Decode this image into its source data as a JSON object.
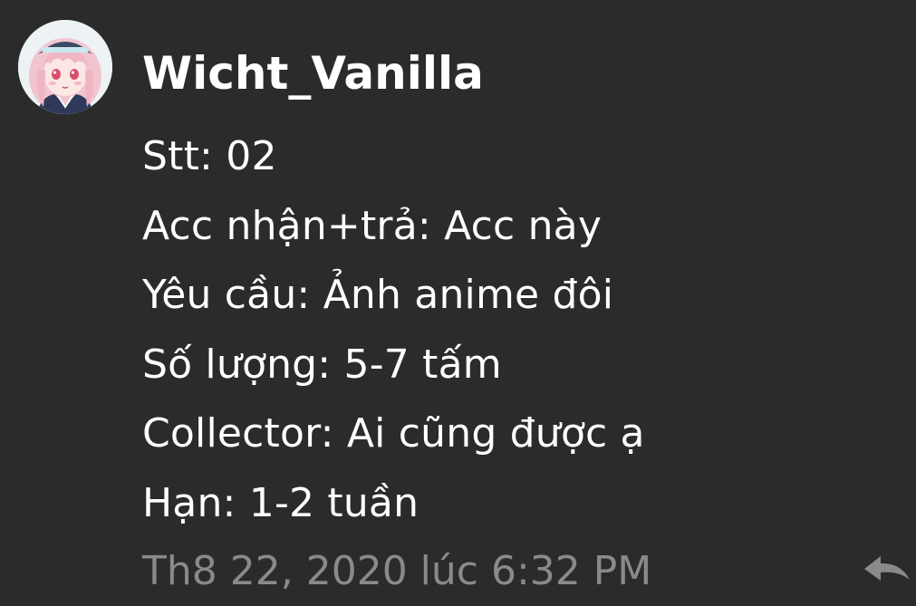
{
  "message": {
    "username": "Wicht_Vanilla",
    "avatar_icon": "anime-girl-avatar-icon",
    "lines": [
      "Stt: 02",
      "Acc nhận+trả: Acc này",
      "Yêu cầu: Ảnh anime đôi",
      "Số lượng: 5-7 tấm",
      "Collector: Ai cũng được ạ",
      "Hạn: 1-2 tuần"
    ],
    "timestamp": "Th8 22, 2020 lúc 6:32 PM",
    "reply_icon": "reply-arrow-icon"
  },
  "colors": {
    "background": "#2b2b2b",
    "text": "#ffffff",
    "timestamp": "#8a8a8a",
    "reply_icon": "#8a8a8a"
  }
}
